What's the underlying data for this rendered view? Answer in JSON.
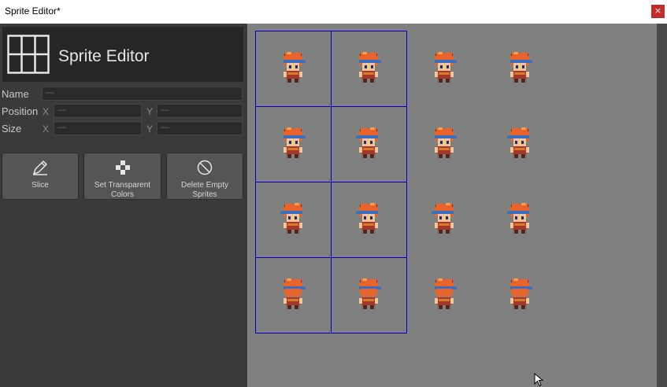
{
  "window": {
    "title": "Sprite Editor*",
    "close_glyph": "×"
  },
  "panel": {
    "heading": "Sprite Editor",
    "logo_icon": "grid-icon",
    "name": {
      "label": "Name",
      "value": "—"
    },
    "position": {
      "label": "Position",
      "x_label": "X",
      "x_value": "—",
      "y_label": "Y",
      "y_value": "—"
    },
    "size": {
      "label": "Size",
      "x_label": "X",
      "x_value": "—",
      "y_label": "Y",
      "y_value": "—"
    },
    "tools": [
      {
        "label": "Slice",
        "icon": "pencil-icon"
      },
      {
        "label": "Set Transparent Colors",
        "icon": "checker-icon"
      },
      {
        "label": "Delete Empty Sprites",
        "icon": "no-entry-icon"
      }
    ]
  },
  "colors": {
    "selection": "#0000d0",
    "canvas_bg": "#808080",
    "hair": "#e8642a",
    "headband": "#3a6fbf",
    "skin": "#f2c49a",
    "tunic": "#a23a2a"
  },
  "sprite_sheet": {
    "rows": 4,
    "cols": 4,
    "selected_rows": 4,
    "selected_cols": 2
  }
}
